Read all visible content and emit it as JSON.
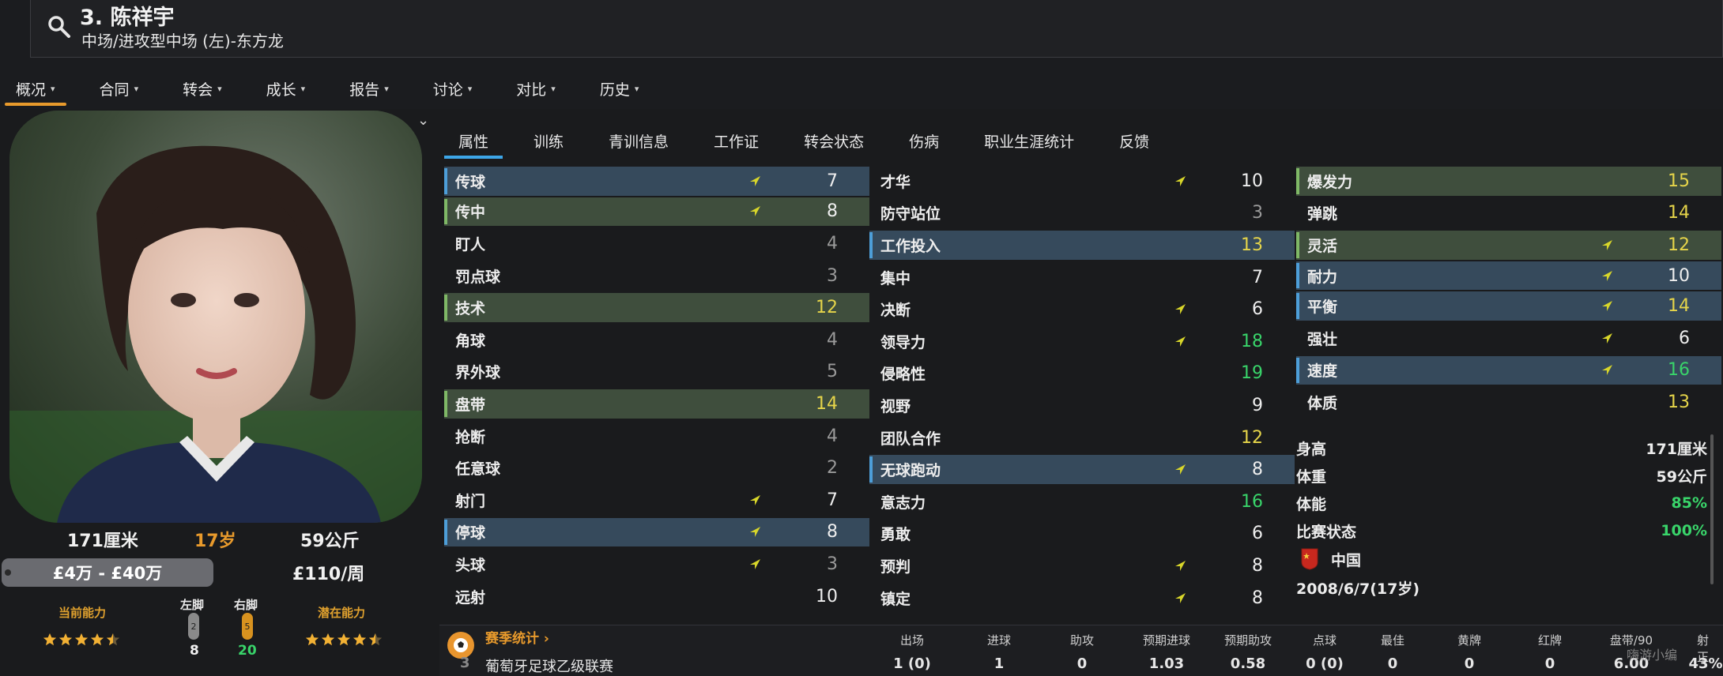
{
  "header": {
    "name": "3. 陈祥宇",
    "role": "中场/进攻型中场 (左)-东方龙"
  },
  "nav": [
    "概况",
    "合同",
    "转会",
    "成长",
    "报告",
    "讨论",
    "对比",
    "历史"
  ],
  "profile": {
    "height": "171厘米",
    "age": "17岁",
    "weight": "59公斤",
    "value": "£4万 - £40万",
    "wage": "£110/周",
    "current_ability_label": "当前能力",
    "left_foot_label": "左脚",
    "right_foot_label": "右脚",
    "left_foot_value": "8",
    "right_foot_value": "20",
    "left_foot_badge": "2",
    "right_foot_badge": "5",
    "potential_label": "潜在能力",
    "current_stars": 4.5,
    "potential_stars": 4.5
  },
  "tabs": [
    "属性",
    "训练",
    "青训信息",
    "工作证",
    "转会状态",
    "伤病",
    "职业生涯统计",
    "反馈"
  ],
  "technical": [
    {
      "name": "传球",
      "value": "7",
      "hl": "b",
      "arrow": true
    },
    {
      "name": "传中",
      "value": "8",
      "hl": "g",
      "arrow": true
    },
    {
      "name": "盯人",
      "value": "4",
      "hl": "",
      "arrow": false
    },
    {
      "name": "罚点球",
      "value": "3",
      "hl": "",
      "arrow": false
    },
    {
      "name": "技术",
      "value": "12",
      "hl": "g",
      "arrow": false
    },
    {
      "name": "角球",
      "value": "4",
      "hl": "",
      "arrow": false
    },
    {
      "name": "界外球",
      "value": "5",
      "hl": "",
      "arrow": false
    },
    {
      "name": "盘带",
      "value": "14",
      "hl": "g",
      "arrow": false
    },
    {
      "name": "抢断",
      "value": "4",
      "hl": "",
      "arrow": false
    },
    {
      "name": "任意球",
      "value": "2",
      "hl": "",
      "arrow": false
    },
    {
      "name": "射门",
      "value": "7",
      "hl": "",
      "arrow": true
    },
    {
      "name": "停球",
      "value": "8",
      "hl": "b",
      "arrow": true
    },
    {
      "name": "头球",
      "value": "3",
      "hl": "",
      "arrow": true
    },
    {
      "name": "远射",
      "value": "10",
      "hl": "",
      "arrow": false
    }
  ],
  "mental": [
    {
      "name": "才华",
      "value": "10",
      "hl": "",
      "arrow": true
    },
    {
      "name": "防守站位",
      "value": "3",
      "hl": "",
      "arrow": false
    },
    {
      "name": "工作投入",
      "value": "13",
      "hl": "b",
      "arrow": false
    },
    {
      "name": "集中",
      "value": "7",
      "hl": "",
      "arrow": false
    },
    {
      "name": "决断",
      "value": "6",
      "hl": "",
      "arrow": true
    },
    {
      "name": "领导力",
      "value": "18",
      "hl": "",
      "arrow": true
    },
    {
      "name": "侵略性",
      "value": "19",
      "hl": "",
      "arrow": false
    },
    {
      "name": "视野",
      "value": "9",
      "hl": "",
      "arrow": false
    },
    {
      "name": "团队合作",
      "value": "12",
      "hl": "",
      "arrow": false
    },
    {
      "name": "无球跑动",
      "value": "8",
      "hl": "b",
      "arrow": true
    },
    {
      "name": "意志力",
      "value": "16",
      "hl": "",
      "arrow": false
    },
    {
      "name": "勇敢",
      "value": "6",
      "hl": "",
      "arrow": false
    },
    {
      "name": "预判",
      "value": "8",
      "hl": "",
      "arrow": true
    },
    {
      "name": "镇定",
      "value": "8",
      "hl": "",
      "arrow": true
    }
  ],
  "physical": [
    {
      "name": "爆发力",
      "value": "15",
      "hl": "g",
      "arrow": false
    },
    {
      "name": "弹跳",
      "value": "14",
      "hl": "",
      "arrow": false
    },
    {
      "name": "灵活",
      "value": "12",
      "hl": "g",
      "arrow": true
    },
    {
      "name": "耐力",
      "value": "10",
      "hl": "b",
      "arrow": true
    },
    {
      "name": "平衡",
      "value": "14",
      "hl": "b",
      "arrow": true
    },
    {
      "name": "强壮",
      "value": "6",
      "hl": "",
      "arrow": true
    },
    {
      "name": "速度",
      "value": "16",
      "hl": "b",
      "arrow": true
    },
    {
      "name": "体质",
      "value": "13",
      "hl": "",
      "arrow": false
    }
  ],
  "info": {
    "height_label": "身高",
    "height_value": "171厘米",
    "weight_label": "体重",
    "weight_value": "59公斤",
    "fitness_label": "体能",
    "fitness_value": "85%",
    "form_label": "比赛状态",
    "form_value": "100%",
    "nation": "中国",
    "dob": "2008/6/7(17岁)"
  },
  "season": {
    "title": "赛季统计 ›",
    "headers": [
      "出场",
      "进球",
      "助攻",
      "预期进球",
      "预期助攻",
      "点球",
      "最佳",
      "黄牌",
      "红牌",
      "盘带/90",
      "射正"
    ],
    "league": "葡萄牙足球乙级联赛",
    "league_badge": "3",
    "row": [
      "1 (0)",
      "1",
      "0",
      "1.03",
      "0.58",
      "0 (0)",
      "0",
      "0",
      "0",
      "6.00",
      "43%"
    ]
  },
  "colors": {
    "accent": "#e89a2c",
    "tab": "#3da6e8",
    "green_hl": "#3f4e3d",
    "blue_hl": "#364a5c"
  },
  "watermark": "嗨游小编"
}
